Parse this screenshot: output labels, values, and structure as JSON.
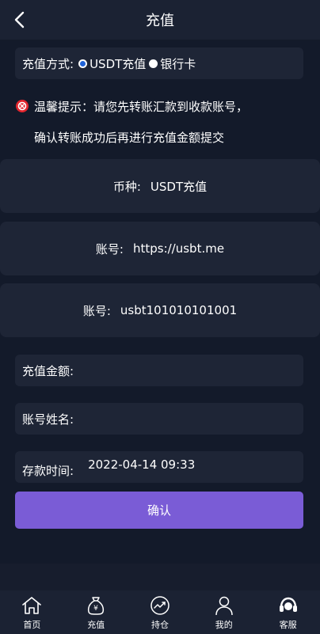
{
  "header": {
    "title": "充值",
    "back_icon": "chevron-left-icon"
  },
  "method": {
    "label": "充值方式:",
    "options": [
      {
        "label": "USDT充值",
        "checked": true
      },
      {
        "label": "银行卡",
        "checked": false
      }
    ]
  },
  "tip": {
    "line1": "温馨提示：请您先转账汇款到收款账号，",
    "line2": "确认转账成功后再进行充值金额提交",
    "icon": "warning-icon",
    "icon_color": "#e3262e"
  },
  "cards": [
    {
      "label": "币种:",
      "value": "USDT充值"
    },
    {
      "label": "账号:",
      "value": "https://usbt.me"
    },
    {
      "label": "账号:",
      "value": "usbt101010101001"
    }
  ],
  "form": {
    "amount_label": "充值金额:",
    "amount_value": "",
    "name_label": "账号姓名:",
    "name_value": "",
    "time_label": "存款时间:",
    "time_value": "2022-04-14 09:33"
  },
  "confirm": {
    "label": "确认",
    "color": "#7a5cd6"
  },
  "tabbar": [
    {
      "label": "首页",
      "icon": "home-icon"
    },
    {
      "label": "充值",
      "icon": "money-bag-icon"
    },
    {
      "label": "持仓",
      "icon": "chart-icon"
    },
    {
      "label": "我的",
      "icon": "user-icon"
    },
    {
      "label": "客服",
      "icon": "headset-icon"
    }
  ]
}
